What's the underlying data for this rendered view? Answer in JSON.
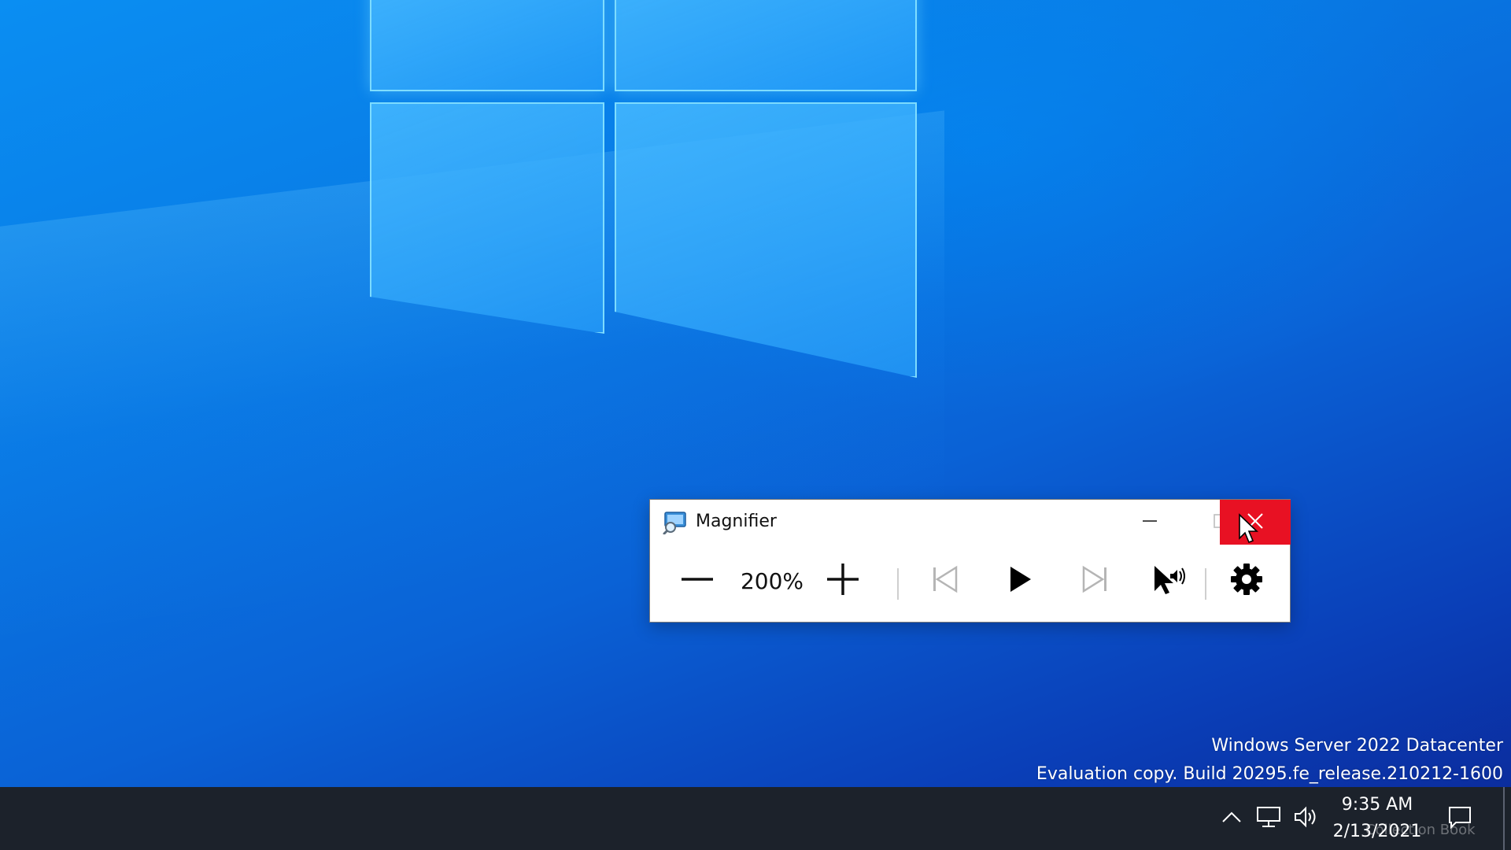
{
  "window": {
    "title": "Magnifier",
    "icon": "magnifier-icon",
    "controls": {
      "minimize": "minimize-icon",
      "maximize": "maximize-icon",
      "close": "close-icon"
    },
    "close_hover_color": "#e81123"
  },
  "toolbar": {
    "zoom_out_icon": "minus-icon",
    "zoom_level": "200%",
    "zoom_in_icon": "plus-icon",
    "previous_icon": "skip-back-icon",
    "play_icon": "play-icon",
    "next_icon": "skip-forward-icon",
    "read_from_pointer_icon": "pointer-speaker-icon",
    "settings_icon": "gear-icon"
  },
  "watermark": {
    "line1": "Windows Server 2022 Datacenter",
    "line2": "Evaluation copy. Build 20295.fe_release.210212-1600"
  },
  "taskbar": {
    "time": "9:35 AM",
    "date": "2/13/2021",
    "tray_icons": [
      "chevron-up-icon",
      "network-icon",
      "volume-icon",
      "notifications-icon"
    ],
    "overlay_text": "Collection Book"
  },
  "colors": {
    "desktop_blue": "#0878e3",
    "taskbar": "#1c222b",
    "close_red": "#e81123"
  }
}
